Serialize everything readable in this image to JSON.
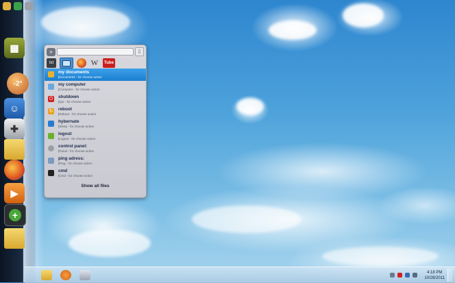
{
  "desktop": {
    "dock": {
      "weather_temp": "-2°",
      "items": [
        {
          "name": "usb-drive-icon",
          "color": "#7a8a2e"
        },
        {
          "name": "weather-widget-icon",
          "color": "#e07a30"
        },
        {
          "name": "robot-icon",
          "color": "#2a6fc0"
        },
        {
          "name": "gamepad-icon",
          "color": "#d8d8d8"
        },
        {
          "name": "folder-icon",
          "color": "#e8c24a"
        },
        {
          "name": "firefox-icon",
          "color": "#e0521f"
        },
        {
          "name": "media-player-icon",
          "color": "#f08a20"
        },
        {
          "name": "add-icon",
          "color": "#4aa83a"
        },
        {
          "name": "folder-icon",
          "color": "#e8c24a"
        }
      ]
    }
  },
  "launcher": {
    "search_value": "",
    "tabs": [
      {
        "name": "text-tab",
        "label": "txt"
      },
      {
        "name": "computer-tab",
        "label": ""
      },
      {
        "name": "firefox-tab",
        "label": ""
      },
      {
        "name": "wikipedia-tab",
        "label": "W"
      },
      {
        "name": "youtube-tab",
        "label": "Tube"
      }
    ],
    "results": [
      {
        "title": "my documents",
        "subtitle": "[Documents - for choose action",
        "icon": "folder-icon",
        "color": "#e8b030",
        "selected": true
      },
      {
        "title": "my computer",
        "subtitle": "[Computer - for choose action",
        "icon": "computer-icon",
        "color": "#6aa8e0",
        "selected": false
      },
      {
        "title": "shutdown",
        "subtitle": "[Qui - for choose action",
        "icon": "power-icon",
        "color": "#d02020",
        "selected": false
      },
      {
        "title": "reboot",
        "subtitle": "[Reboot - for choose action",
        "icon": "reboot-icon",
        "color": "#e8a020",
        "selected": false
      },
      {
        "title": "hybernate",
        "subtitle": "[Sleep - for choose action",
        "icon": "hibernate-icon",
        "color": "#2a7ad0",
        "selected": false
      },
      {
        "title": "logout",
        "subtitle": "[Logout - for choose action",
        "icon": "logout-icon",
        "color": "#6ab030",
        "selected": false
      },
      {
        "title": "control panel:",
        "subtitle": "[Panel - for choose action",
        "icon": "control-panel-icon",
        "color": "#9aa0a8",
        "selected": false
      },
      {
        "title": "ping adress:",
        "subtitle": "[Ping - for choose action",
        "icon": "ping-icon",
        "color": "#7a9ac0",
        "selected": false
      },
      {
        "title": "cmd",
        "subtitle": "[Cmd - for choose action",
        "icon": "cmd-icon",
        "color": "#222222",
        "selected": false
      }
    ],
    "show_all_label": "Show all files"
  },
  "taskbar": {
    "pinned": [
      {
        "name": "explorer-icon",
        "color": "#e8c24a"
      },
      {
        "name": "media-player-icon",
        "color": "#f08a20"
      },
      {
        "name": "paint-icon",
        "color": "#b0b8c8"
      }
    ],
    "clock_time": "4:18 PM",
    "clock_date": "10/28/2011"
  }
}
